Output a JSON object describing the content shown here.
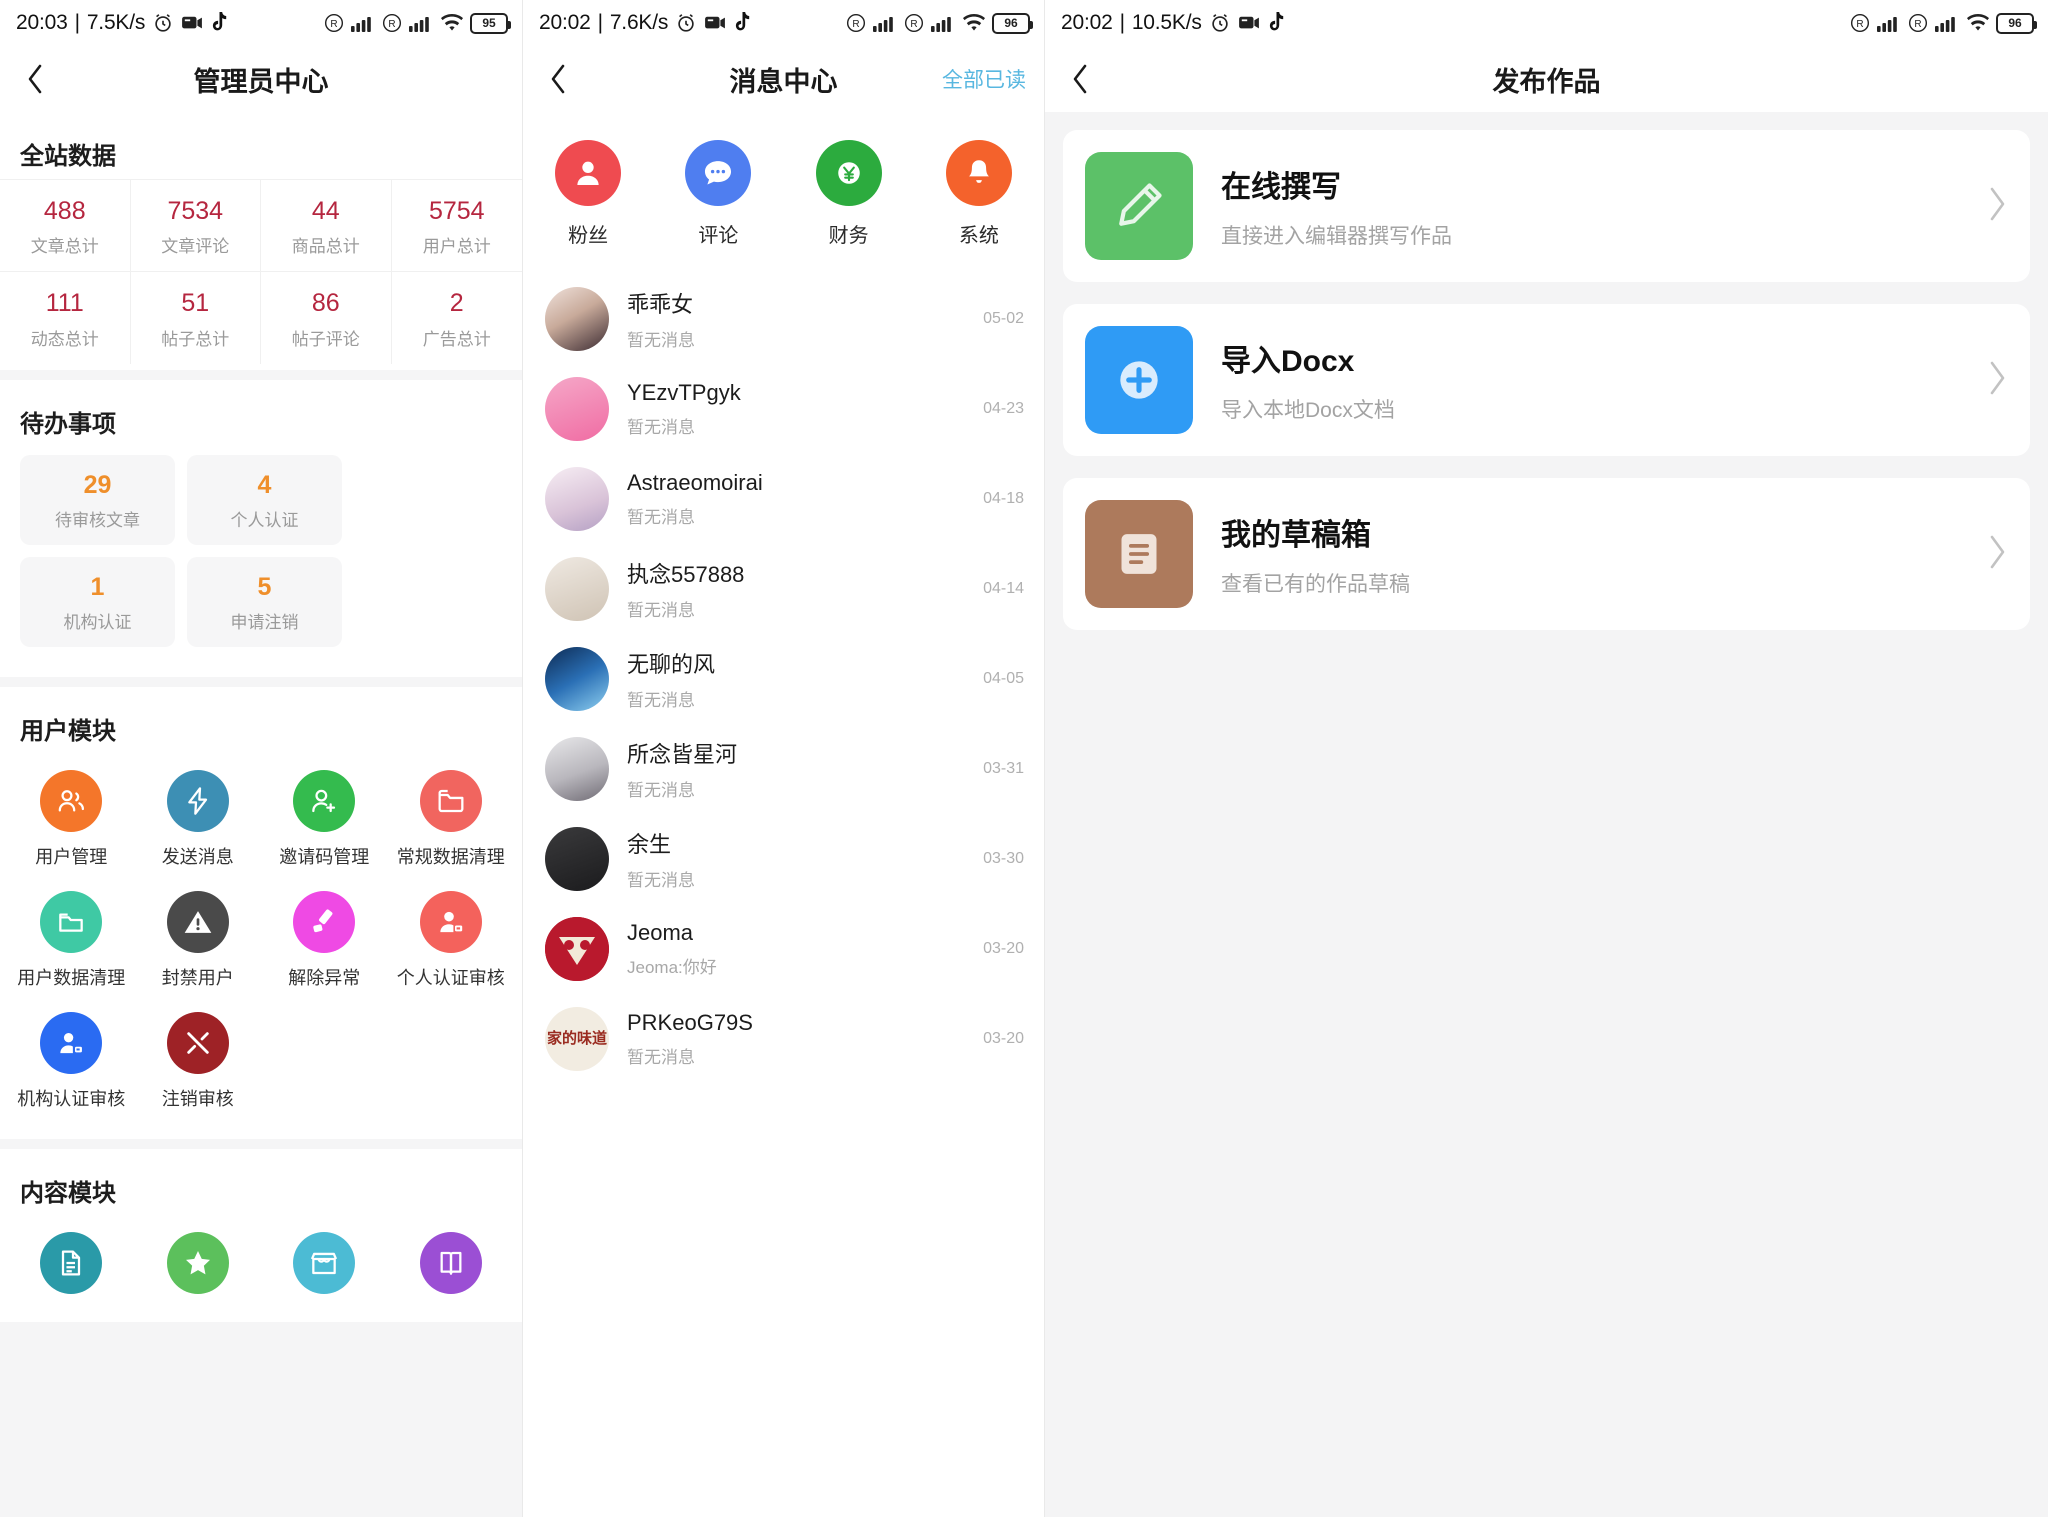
{
  "panels": [
    {
      "status": {
        "time": "20:03",
        "speed": "7.5K/s",
        "battery": "95"
      },
      "nav": {
        "title": "管理员中心",
        "back_icon": "chevron-left-icon"
      },
      "site_stats": {
        "title": "全站数据",
        "cells": [
          {
            "value": "488",
            "label": "文章总计"
          },
          {
            "value": "7534",
            "label": "文章评论"
          },
          {
            "value": "44",
            "label": "商品总计"
          },
          {
            "value": "5754",
            "label": "用户总计"
          },
          {
            "value": "111",
            "label": "动态总计"
          },
          {
            "value": "51",
            "label": "帖子总计"
          },
          {
            "value": "86",
            "label": "帖子评论"
          },
          {
            "value": "2",
            "label": "广告总计"
          }
        ]
      },
      "todo": {
        "title": "待办事项",
        "items": [
          {
            "value": "29",
            "label": "待审核文章"
          },
          {
            "value": "4",
            "label": "个人认证"
          },
          {
            "value": "1",
            "label": "机构认证"
          },
          {
            "value": "5",
            "label": "申请注销"
          }
        ]
      },
      "user_module": {
        "title": "用户模块",
        "items": [
          {
            "label": "用户管理",
            "icon": "users-icon",
            "color": "#f4762a"
          },
          {
            "label": "发送消息",
            "icon": "lightning-icon",
            "color": "#3d8fb4"
          },
          {
            "label": "邀请码管理",
            "icon": "user-plus-icon",
            "color": "#34bb4e"
          },
          {
            "label": "常规数据清理",
            "icon": "folder-icon",
            "color": "#f1655f"
          },
          {
            "label": "用户数据清理",
            "icon": "folder-open-icon",
            "color": "#3fc9a4"
          },
          {
            "label": "封禁用户",
            "icon": "warning-icon",
            "color": "#4a4a4a"
          },
          {
            "label": "解除异常",
            "icon": "unlock-hammer-icon",
            "color": "#ef4ae4"
          },
          {
            "label": "个人认证审核",
            "icon": "user-card-icon",
            "color": "#f4625c"
          },
          {
            "label": "机构认证审核",
            "icon": "id-badge-icon",
            "color": "#2a6bf2"
          },
          {
            "label": "注销审核",
            "icon": "tools-icon",
            "color": "#9e2226"
          }
        ]
      },
      "content_module": {
        "title": "内容模块",
        "items": [
          {
            "label": "",
            "icon": "document-icon",
            "color": "#2a9aa8"
          },
          {
            "label": "",
            "icon": "star-icon",
            "color": "#5cc05c"
          },
          {
            "label": "",
            "icon": "shop-icon",
            "color": "#4cbbd4"
          },
          {
            "label": "",
            "icon": "book-icon",
            "color": "#9b4fd4"
          }
        ]
      }
    },
    {
      "status": {
        "time": "20:02",
        "speed": "7.6K/s",
        "battery": "96"
      },
      "nav": {
        "title": "消息中心",
        "back_icon": "chevron-left-icon",
        "action": "全部已读",
        "action_color": "#58b7e0"
      },
      "categories": [
        {
          "label": "粉丝",
          "icon": "fan-user-icon",
          "color": "#ef4b50"
        },
        {
          "label": "评论",
          "icon": "comment-icon",
          "color": "#4f7ef0"
        },
        {
          "label": "财务",
          "icon": "yuan-coin-icon",
          "color": "#2cab3e"
        },
        {
          "label": "系统",
          "icon": "bell-icon",
          "color": "#f4622c"
        }
      ],
      "messages": [
        {
          "name": "乖乖女",
          "preview": "暂无消息",
          "date": "05-02",
          "avatar": "av-a",
          "initials": ""
        },
        {
          "name": "YEzvTPgyk",
          "preview": "暂无消息",
          "date": "04-23",
          "avatar": "av-b",
          "initials": ""
        },
        {
          "name": "Astraeomoirai",
          "preview": "暂无消息",
          "date": "04-18",
          "avatar": "av-c",
          "initials": ""
        },
        {
          "name": "执念557888",
          "preview": "暂无消息",
          "date": "04-14",
          "avatar": "av-d",
          "initials": ""
        },
        {
          "name": "无聊的风",
          "preview": "暂无消息",
          "date": "04-05",
          "avatar": "av-e",
          "initials": ""
        },
        {
          "name": "所念皆星河",
          "preview": "暂无消息",
          "date": "03-31",
          "avatar": "av-f",
          "initials": ""
        },
        {
          "name": "余生",
          "preview": "暂无消息",
          "date": "03-30",
          "avatar": "av-g",
          "initials": ""
        },
        {
          "name": "Jeoma",
          "preview": "Jeoma:你好",
          "date": "03-20",
          "avatar": "av-h",
          "initials": ""
        },
        {
          "name": "PRKeoG79S",
          "preview": "暂无消息",
          "date": "03-20",
          "avatar": "av-i",
          "initials": "家的味道"
        }
      ]
    },
    {
      "status": {
        "time": "20:02",
        "speed": "10.5K/s",
        "battery": "96"
      },
      "nav": {
        "title": "发布作品",
        "back_icon": "chevron-left-icon"
      },
      "actions": [
        {
          "title": "在线撰写",
          "desc": "直接进入编辑器撰写作品",
          "icon": "pencil-icon",
          "color": "#5cc168",
          "chevron": "chevron-right-icon"
        },
        {
          "title": "导入Docx",
          "desc": "导入本地Docx文档",
          "icon": "plus-circle-icon",
          "color": "#2f9bf5",
          "chevron": "chevron-right-icon"
        },
        {
          "title": "我的草稿箱",
          "desc": "查看已有的作品草稿",
          "icon": "bookmark-icon",
          "color": "#ad7a5c",
          "chevron": "chevron-right-icon"
        }
      ]
    }
  ]
}
